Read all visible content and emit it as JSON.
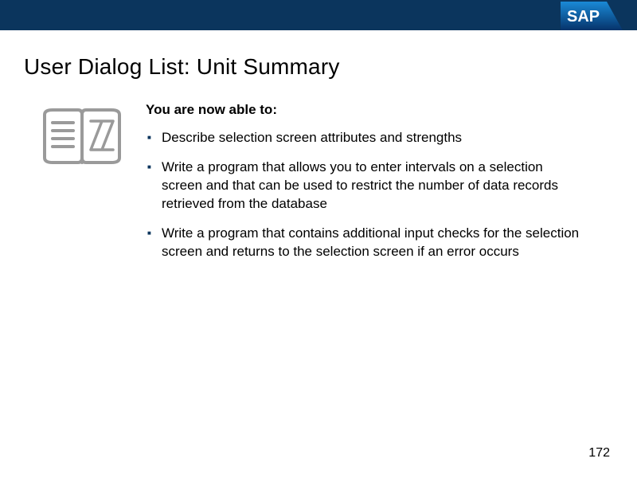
{
  "logo_text": "SAP",
  "title": "User Dialog List: Unit Summary",
  "lead": "You are now able to:",
  "bullets": [
    "Describe selection screen attributes and strengths",
    "Write a program that allows you to enter intervals on a selection screen and that can be used to restrict the number of data records retrieved from the database",
    "Write a program that contains additional input checks for the selection screen and returns to the selection screen if an error occurs"
  ],
  "page_number": "172",
  "icon_name": "open-book-summary"
}
